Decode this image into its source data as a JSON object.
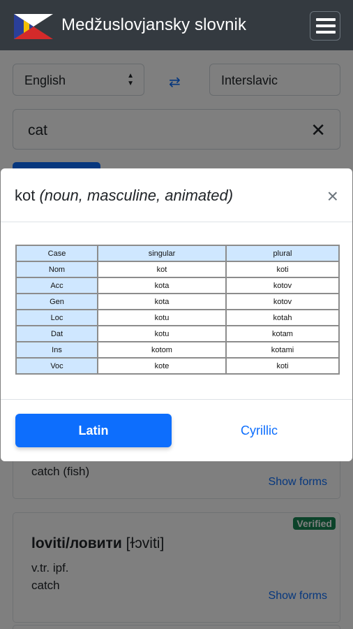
{
  "app": {
    "title": "Medžuslovjansky slovnik"
  },
  "search": {
    "source_lang": "English",
    "target_lang": "Interslavic",
    "query": "cat"
  },
  "results": [
    {
      "meaning": "catch (fish)",
      "show_forms": "Show forms"
    },
    {
      "badge": "Verified",
      "word": "loviti/ловити",
      "ipa": "[ɫɔviti]",
      "pos": "v.tr. ipf.",
      "meaning": "catch",
      "show_forms": "Show forms"
    }
  ],
  "modal": {
    "lemma": "kot",
    "grammar": "(noun, masculine, animated)",
    "table": {
      "headers": [
        "Case",
        "singular",
        "plural"
      ],
      "rows": [
        [
          "Nom",
          "kot",
          "koti"
        ],
        [
          "Acc",
          "kota",
          "kotov"
        ],
        [
          "Gen",
          "kota",
          "kotov"
        ],
        [
          "Loc",
          "kotu",
          "kotah"
        ],
        [
          "Dat",
          "kotu",
          "kotam"
        ],
        [
          "Ins",
          "kotom",
          "kotami"
        ],
        [
          "Voc",
          "kote",
          "koti"
        ]
      ]
    },
    "btn_latin": "Latin",
    "btn_cyrillic": "Cyrillic"
  },
  "colors": {
    "navbar": "#343a40",
    "primary": "#0d6efd",
    "table_header": "#cfe7ff",
    "badge": "#198754"
  },
  "icons": {
    "flag": "flag-icon",
    "menu": "hamburger-menu-icon",
    "swap": "swap-arrows-icon",
    "clear": "close-x-icon",
    "modal_close": "close-icon"
  }
}
